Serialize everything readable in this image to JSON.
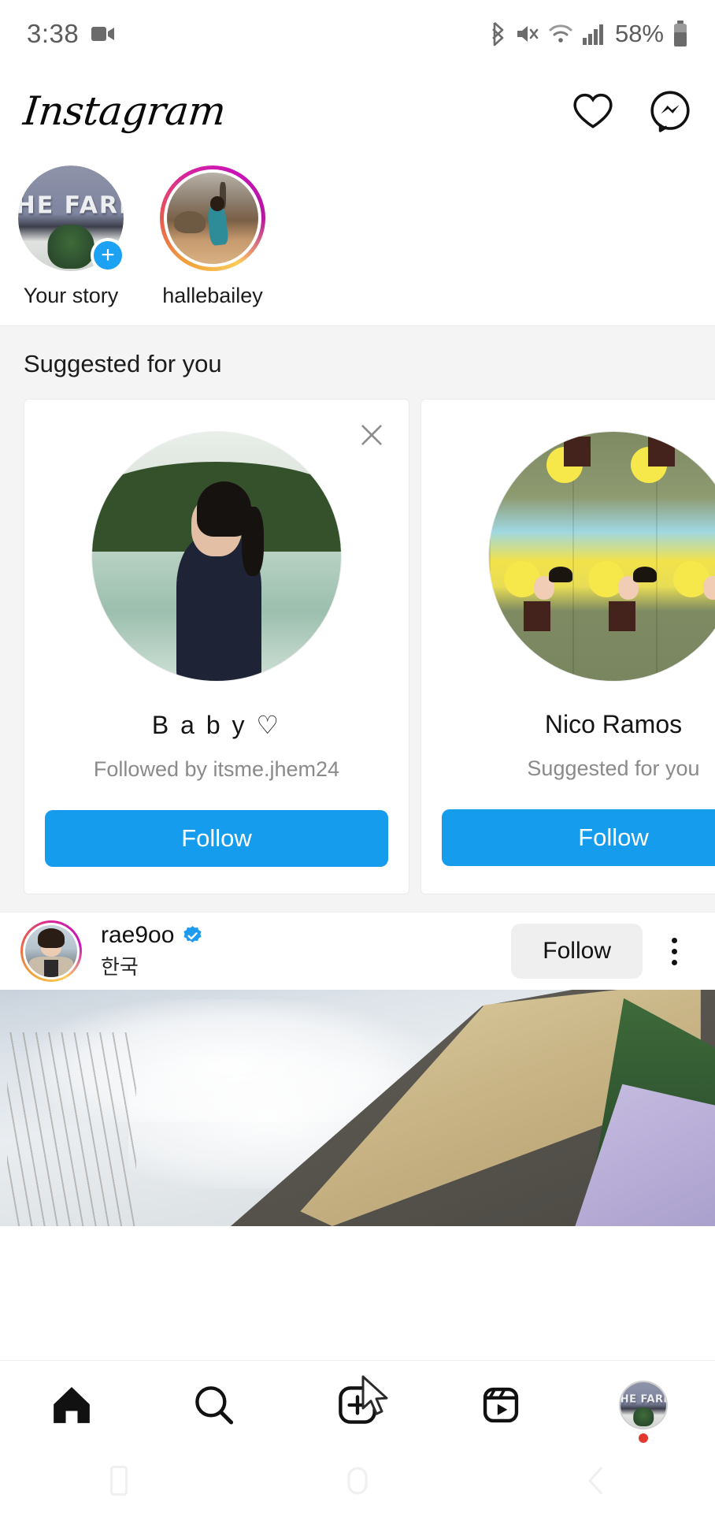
{
  "status_bar": {
    "time": "3:38",
    "battery_percent": "58%",
    "icons": [
      "video-recording-icon",
      "bluetooth-icon",
      "mute-icon",
      "wifi-icon",
      "cellular-signal-icon",
      "battery-icon"
    ]
  },
  "app_header": {
    "logo_text": "Instagram",
    "activity_icon": "heart-icon",
    "messenger_icon": "messenger-icon"
  },
  "stories": [
    {
      "label": "Your story",
      "has_ring": false,
      "has_add_badge": true,
      "add_badge_color": "#1da1f2"
    },
    {
      "label": "hallebailey",
      "has_ring": true,
      "has_add_badge": false
    }
  ],
  "suggested": {
    "section_title": "Suggested for you",
    "cards": [
      {
        "name": "B a b y ♡",
        "subtitle": "Followed by itsme.jhem24",
        "follow_label": "Follow",
        "close_icon": "close-icon",
        "has_close": true,
        "spaced_name": true
      },
      {
        "name": "Nico Ramos",
        "subtitle": "Suggested for you",
        "follow_label": "Follow",
        "close_icon": "close-icon",
        "has_close": false,
        "spaced_name": false
      }
    ]
  },
  "post": {
    "username": "rae9oo",
    "verified": true,
    "location": "한국",
    "follow_label": "Follow",
    "more_icon": "more-vertical-icon"
  },
  "bottom_nav": {
    "items": [
      {
        "icon": "home-icon",
        "active": true
      },
      {
        "icon": "search-icon",
        "active": false
      },
      {
        "icon": "create-post-icon",
        "active": false
      },
      {
        "icon": "reels-icon",
        "active": false
      },
      {
        "icon": "profile-avatar",
        "active": false,
        "has_notification_dot": true
      }
    ],
    "cursor_icon": "mouse-cursor"
  },
  "android_nav": {
    "items": [
      "recents-icon",
      "home-icon",
      "back-icon"
    ]
  },
  "colors": {
    "instagram_blue": "#169ced",
    "verified_blue": "#1d9bf0",
    "notification_red": "#e03a2f",
    "suggested_bg": "#f4f4f4",
    "gray_button_bg": "#efefef"
  }
}
